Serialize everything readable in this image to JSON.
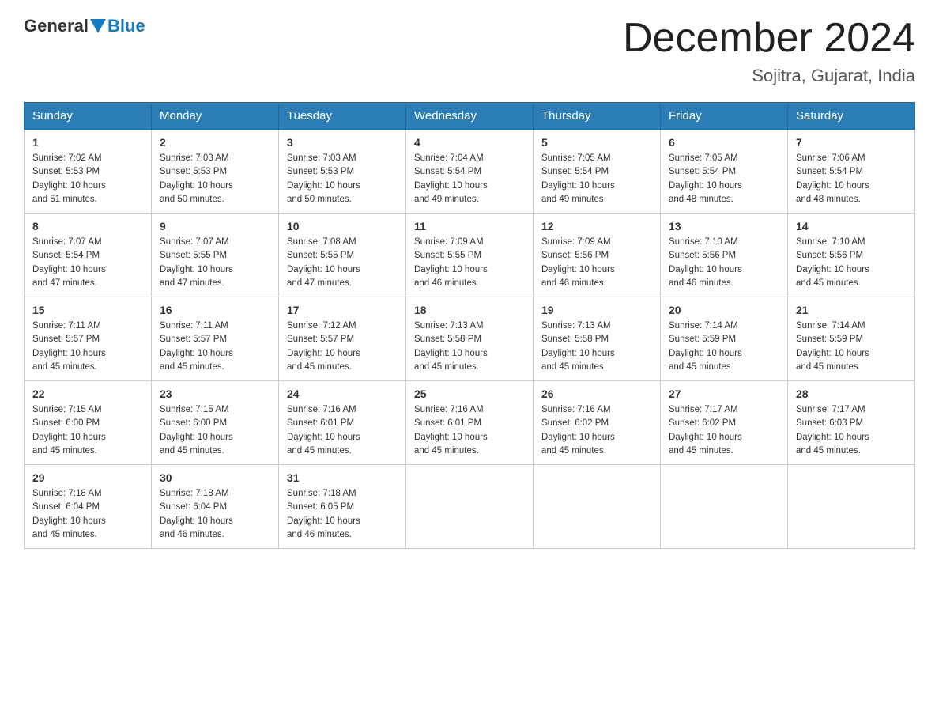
{
  "header": {
    "logo_general": "General",
    "logo_blue": "Blue",
    "month_title": "December 2024",
    "location": "Sojitra, Gujarat, India"
  },
  "days_of_week": [
    "Sunday",
    "Monday",
    "Tuesday",
    "Wednesday",
    "Thursday",
    "Friday",
    "Saturday"
  ],
  "weeks": [
    [
      {
        "num": "1",
        "sunrise": "7:02 AM",
        "sunset": "5:53 PM",
        "daylight": "10 hours and 51 minutes."
      },
      {
        "num": "2",
        "sunrise": "7:03 AM",
        "sunset": "5:53 PM",
        "daylight": "10 hours and 50 minutes."
      },
      {
        "num": "3",
        "sunrise": "7:03 AM",
        "sunset": "5:53 PM",
        "daylight": "10 hours and 50 minutes."
      },
      {
        "num": "4",
        "sunrise": "7:04 AM",
        "sunset": "5:54 PM",
        "daylight": "10 hours and 49 minutes."
      },
      {
        "num": "5",
        "sunrise": "7:05 AM",
        "sunset": "5:54 PM",
        "daylight": "10 hours and 49 minutes."
      },
      {
        "num": "6",
        "sunrise": "7:05 AM",
        "sunset": "5:54 PM",
        "daylight": "10 hours and 48 minutes."
      },
      {
        "num": "7",
        "sunrise": "7:06 AM",
        "sunset": "5:54 PM",
        "daylight": "10 hours and 48 minutes."
      }
    ],
    [
      {
        "num": "8",
        "sunrise": "7:07 AM",
        "sunset": "5:54 PM",
        "daylight": "10 hours and 47 minutes."
      },
      {
        "num": "9",
        "sunrise": "7:07 AM",
        "sunset": "5:55 PM",
        "daylight": "10 hours and 47 minutes."
      },
      {
        "num": "10",
        "sunrise": "7:08 AM",
        "sunset": "5:55 PM",
        "daylight": "10 hours and 47 minutes."
      },
      {
        "num": "11",
        "sunrise": "7:09 AM",
        "sunset": "5:55 PM",
        "daylight": "10 hours and 46 minutes."
      },
      {
        "num": "12",
        "sunrise": "7:09 AM",
        "sunset": "5:56 PM",
        "daylight": "10 hours and 46 minutes."
      },
      {
        "num": "13",
        "sunrise": "7:10 AM",
        "sunset": "5:56 PM",
        "daylight": "10 hours and 46 minutes."
      },
      {
        "num": "14",
        "sunrise": "7:10 AM",
        "sunset": "5:56 PM",
        "daylight": "10 hours and 45 minutes."
      }
    ],
    [
      {
        "num": "15",
        "sunrise": "7:11 AM",
        "sunset": "5:57 PM",
        "daylight": "10 hours and 45 minutes."
      },
      {
        "num": "16",
        "sunrise": "7:11 AM",
        "sunset": "5:57 PM",
        "daylight": "10 hours and 45 minutes."
      },
      {
        "num": "17",
        "sunrise": "7:12 AM",
        "sunset": "5:57 PM",
        "daylight": "10 hours and 45 minutes."
      },
      {
        "num": "18",
        "sunrise": "7:13 AM",
        "sunset": "5:58 PM",
        "daylight": "10 hours and 45 minutes."
      },
      {
        "num": "19",
        "sunrise": "7:13 AM",
        "sunset": "5:58 PM",
        "daylight": "10 hours and 45 minutes."
      },
      {
        "num": "20",
        "sunrise": "7:14 AM",
        "sunset": "5:59 PM",
        "daylight": "10 hours and 45 minutes."
      },
      {
        "num": "21",
        "sunrise": "7:14 AM",
        "sunset": "5:59 PM",
        "daylight": "10 hours and 45 minutes."
      }
    ],
    [
      {
        "num": "22",
        "sunrise": "7:15 AM",
        "sunset": "6:00 PM",
        "daylight": "10 hours and 45 minutes."
      },
      {
        "num": "23",
        "sunrise": "7:15 AM",
        "sunset": "6:00 PM",
        "daylight": "10 hours and 45 minutes."
      },
      {
        "num": "24",
        "sunrise": "7:16 AM",
        "sunset": "6:01 PM",
        "daylight": "10 hours and 45 minutes."
      },
      {
        "num": "25",
        "sunrise": "7:16 AM",
        "sunset": "6:01 PM",
        "daylight": "10 hours and 45 minutes."
      },
      {
        "num": "26",
        "sunrise": "7:16 AM",
        "sunset": "6:02 PM",
        "daylight": "10 hours and 45 minutes."
      },
      {
        "num": "27",
        "sunrise": "7:17 AM",
        "sunset": "6:02 PM",
        "daylight": "10 hours and 45 minutes."
      },
      {
        "num": "28",
        "sunrise": "7:17 AM",
        "sunset": "6:03 PM",
        "daylight": "10 hours and 45 minutes."
      }
    ],
    [
      {
        "num": "29",
        "sunrise": "7:18 AM",
        "sunset": "6:04 PM",
        "daylight": "10 hours and 45 minutes."
      },
      {
        "num": "30",
        "sunrise": "7:18 AM",
        "sunset": "6:04 PM",
        "daylight": "10 hours and 46 minutes."
      },
      {
        "num": "31",
        "sunrise": "7:18 AM",
        "sunset": "6:05 PM",
        "daylight": "10 hours and 46 minutes."
      },
      null,
      null,
      null,
      null
    ]
  ],
  "labels": {
    "sunrise": "Sunrise:",
    "sunset": "Sunset:",
    "daylight": "Daylight:"
  }
}
